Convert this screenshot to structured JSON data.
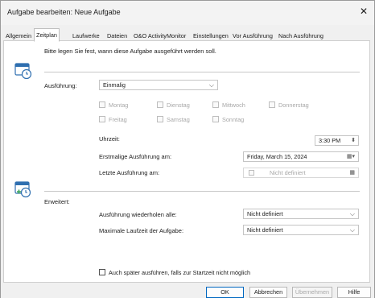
{
  "window": {
    "title": "Aufgabe bearbeiten: Neue Aufgabe"
  },
  "tabs": [
    {
      "label": "Allgemein"
    },
    {
      "label": "Zeitplan"
    },
    {
      "label": "Laufwerke"
    },
    {
      "label": "Dateien"
    },
    {
      "label": "O&O ActivityMonitor"
    },
    {
      "label": "Einstellungen"
    },
    {
      "label": "Vor Ausführung"
    },
    {
      "label": "Nach Ausführung"
    }
  ],
  "schedule": {
    "intro": "Bitte legen Sie fest, wann diese Aufgabe ausgeführt werden soll.",
    "execution_label": "Ausführung:",
    "execution_value": "Einmalig",
    "days": [
      {
        "label": "Montag"
      },
      {
        "label": "Dienstag"
      },
      {
        "label": "Mittwoch"
      },
      {
        "label": "Donnerstag"
      },
      {
        "label": "Freitag"
      },
      {
        "label": "Samstag"
      },
      {
        "label": "Sonntag"
      }
    ],
    "time_label": "Uhrzeit:",
    "time_value": "3:30 PM",
    "first_run_label": "Erstmalige Ausführung am:",
    "first_run_value": "Friday, March 15, 2024",
    "last_run_label": "Letzte Ausführung am:",
    "last_run_value": "Nicht definiert"
  },
  "advanced": {
    "label": "Erweitert:",
    "repeat_label": "Ausführung wiederholen alle:",
    "repeat_value": "Nicht definiert",
    "max_runtime_label": "Maximale Laufzeit der Aufgabe:",
    "max_runtime_value": "Nicht definiert",
    "run_later_label": "Auch später ausführen, falls zur Startzeit nicht möglich"
  },
  "buttons": {
    "ok": "OK",
    "cancel": "Abbrechen",
    "apply": "Übernehmen",
    "help": "Hilfe"
  },
  "colors": {
    "accent": "#0067c0",
    "icon_blue": "#2f6fb0",
    "icon_green": "#3aa55a"
  }
}
